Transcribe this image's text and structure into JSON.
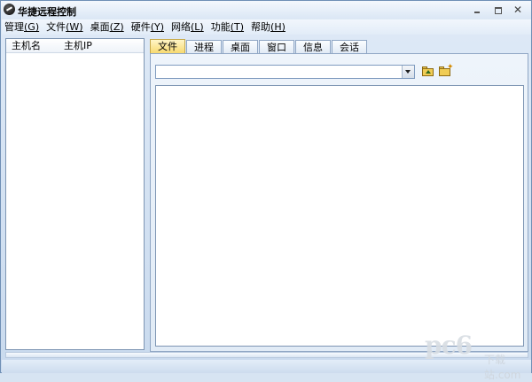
{
  "window": {
    "title": "华捷远程控制",
    "controls": {
      "minimize": "",
      "maximize": "",
      "close": "✕"
    }
  },
  "menu": [
    {
      "label": "管理",
      "accel": "(G)"
    },
    {
      "label": "文件",
      "accel": "(W)"
    },
    {
      "label": "桌面",
      "accel": "(Z)"
    },
    {
      "label": "硬件",
      "accel": "(Y)"
    },
    {
      "label": "网络",
      "accel": "(L)"
    },
    {
      "label": "功能",
      "accel": "(T)"
    },
    {
      "label": "帮助",
      "accel": "(H)"
    }
  ],
  "host_list": {
    "columns": [
      "主机名",
      "主机IP"
    ]
  },
  "tabs": [
    {
      "label": "文件",
      "active": true
    },
    {
      "label": "进程"
    },
    {
      "label": "桌面"
    },
    {
      "label": "窗口"
    },
    {
      "label": "信息"
    },
    {
      "label": "会话"
    }
  ],
  "file_panel": {
    "path_value": "",
    "toolbar_icons": [
      "folder-up-icon",
      "new-folder-icon"
    ]
  },
  "watermark": {
    "main": "pc6",
    "sub": "下载站",
    "domain": ".com"
  }
}
